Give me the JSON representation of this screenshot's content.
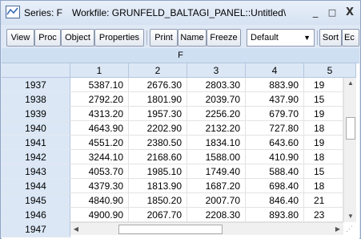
{
  "window": {
    "title_series": "Series: F",
    "title_workfile": "Workfile: GRUNFELD_BALTAGI_PANEL::Untitled\\",
    "minimize_glyph": "_",
    "maximize_glyph": "□",
    "close_glyph": "X",
    "icon": "series-icon"
  },
  "toolbar": {
    "buttons": [
      "View",
      "Proc",
      "Object",
      "Properties",
      "Print",
      "Name",
      "Freeze",
      "Sort",
      "Ec"
    ],
    "select_value": "Default",
    "select_arrow": "▼"
  },
  "sheet": {
    "series_name": "F",
    "columns": [
      "1",
      "2",
      "3",
      "4",
      "5"
    ],
    "rows": [
      {
        "year": "1937",
        "cells": [
          "5387.10",
          "2676.30",
          "2803.30",
          "883.90",
          "19"
        ]
      },
      {
        "year": "1938",
        "cells": [
          "2792.20",
          "1801.90",
          "2039.70",
          "437.90",
          "15"
        ]
      },
      {
        "year": "1939",
        "cells": [
          "4313.20",
          "1957.30",
          "2256.20",
          "679.70",
          "19"
        ]
      },
      {
        "year": "1940",
        "cells": [
          "4643.90",
          "2202.90",
          "2132.20",
          "727.80",
          "18"
        ]
      },
      {
        "year": "1941",
        "cells": [
          "4551.20",
          "2380.50",
          "1834.10",
          "643.60",
          "19"
        ]
      },
      {
        "year": "1942",
        "cells": [
          "3244.10",
          "2168.60",
          "1588.00",
          "410.90",
          "18"
        ]
      },
      {
        "year": "1943",
        "cells": [
          "4053.70",
          "1985.10",
          "1749.40",
          "588.40",
          "15"
        ]
      },
      {
        "year": "1944",
        "cells": [
          "4379.30",
          "1813.90",
          "1687.20",
          "698.40",
          "18"
        ]
      },
      {
        "year": "1945",
        "cells": [
          "4840.90",
          "1850.20",
          "2007.70",
          "846.40",
          "21"
        ]
      },
      {
        "year": "1946",
        "cells": [
          "4900.90",
          "2067.70",
          "2208.30",
          "893.80",
          "23"
        ]
      }
    ],
    "last_row_year": "1947"
  },
  "scroll": {
    "up": "▲",
    "down": "▼",
    "left": "◀",
    "right": "▶"
  }
}
